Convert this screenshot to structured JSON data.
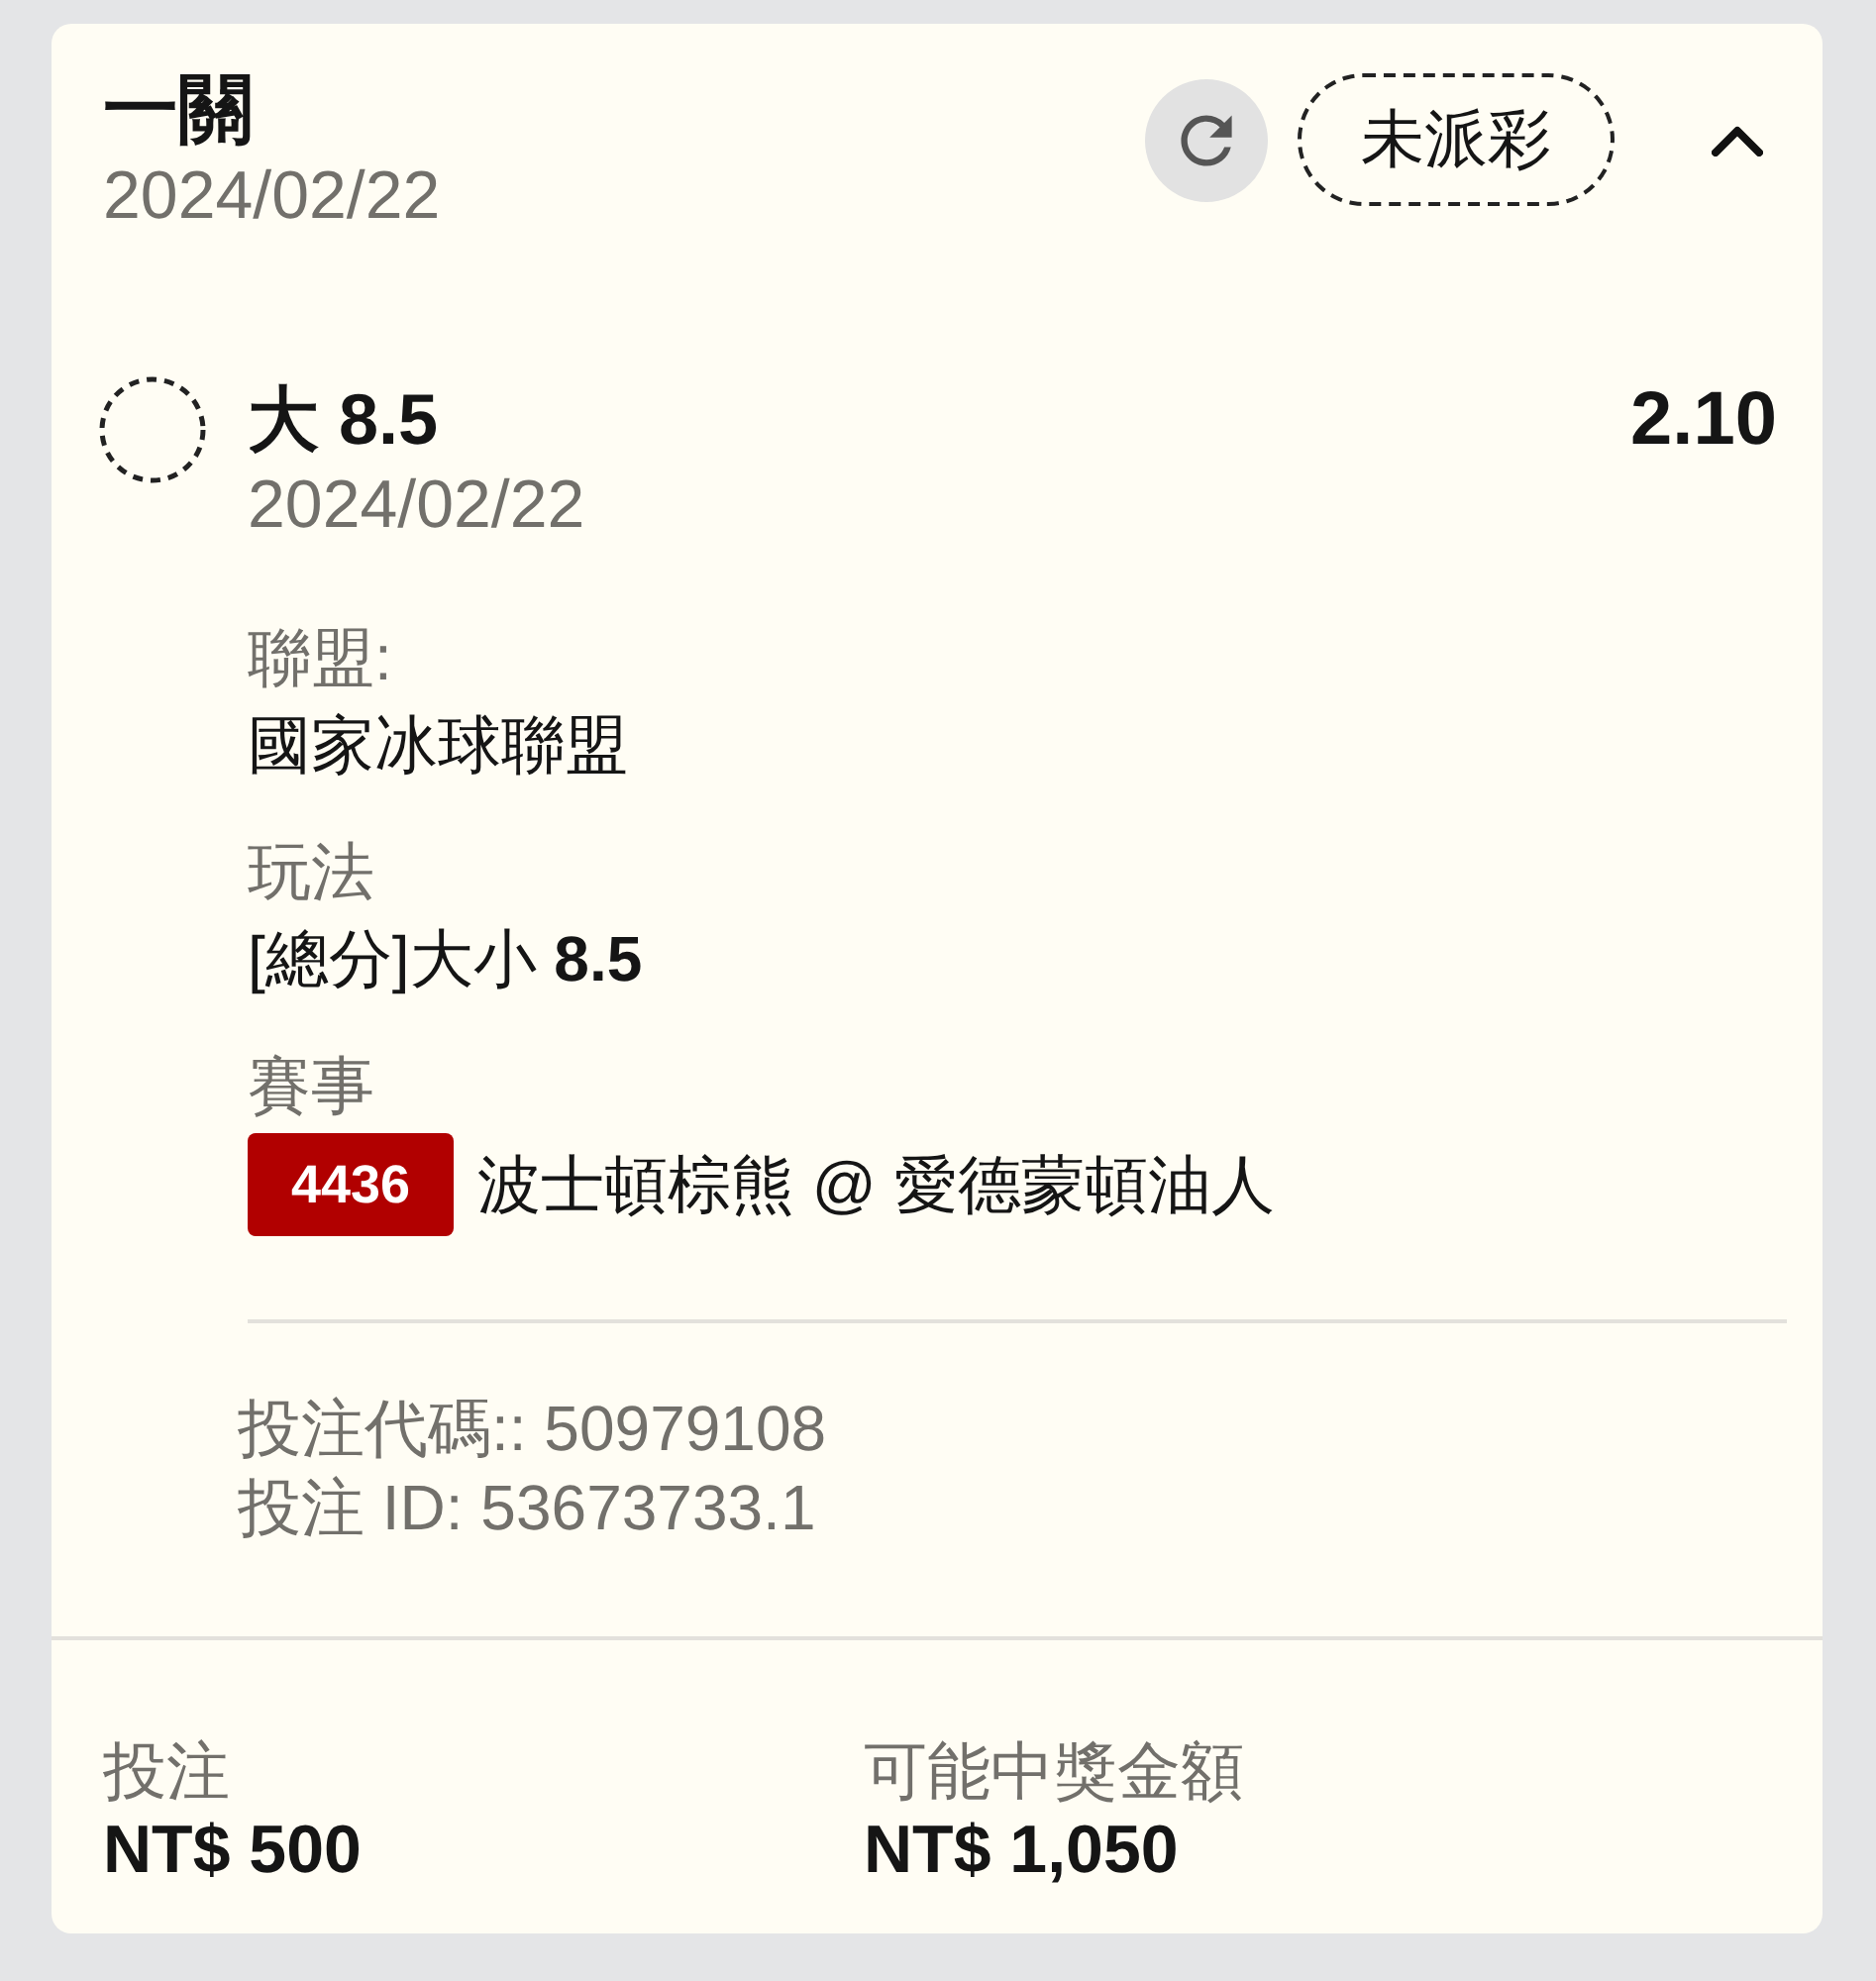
{
  "header": {
    "title": "一關",
    "date": "2024/02/22",
    "status": "未派彩",
    "expanded": true
  },
  "selection": {
    "settled": false,
    "pick": "大 8.5",
    "date": "2024/02/22",
    "odds": "2.10",
    "details": [
      {
        "kind": "text",
        "label": "聯盟:",
        "value": "國家冰球聯盟"
      },
      {
        "kind": "text",
        "label": "玩法",
        "value": "[總分]大小 **8.5**"
      },
      {
        "kind": "match",
        "label": "賽事",
        "event_code": "4436",
        "value": "波士頓棕熊 @ 愛德蒙頓油人"
      }
    ],
    "references": [
      "投注代碼:: 50979108",
      "投注 ID: 53673733.1"
    ]
  },
  "footer": [
    {
      "label": "投注",
      "value": "NT$ 500"
    },
    {
      "label": "可能中獎金額",
      "value": "NT$ 1,050"
    }
  ]
}
